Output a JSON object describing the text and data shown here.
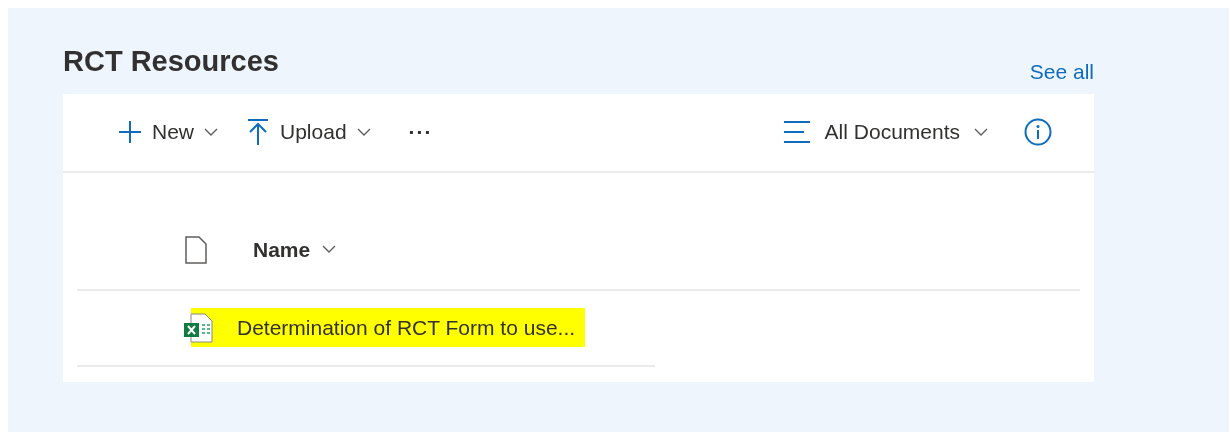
{
  "title": "RCT Resources",
  "see_all": "See all",
  "toolbar": {
    "commands": [
      {
        "label": "New",
        "kind": "plus",
        "dropdown": true
      },
      {
        "label": "Upload",
        "kind": "upload",
        "dropdown": true
      }
    ],
    "more": "···",
    "view": {
      "label": "All Documents",
      "dropdown": true
    }
  },
  "table": {
    "columns": [
      {
        "label": "Name",
        "sortable": true
      }
    ],
    "rows": [
      {
        "name": "Determination of RCT Form to use...",
        "kind": "spreadsheet",
        "highlighted": true
      }
    ]
  }
}
